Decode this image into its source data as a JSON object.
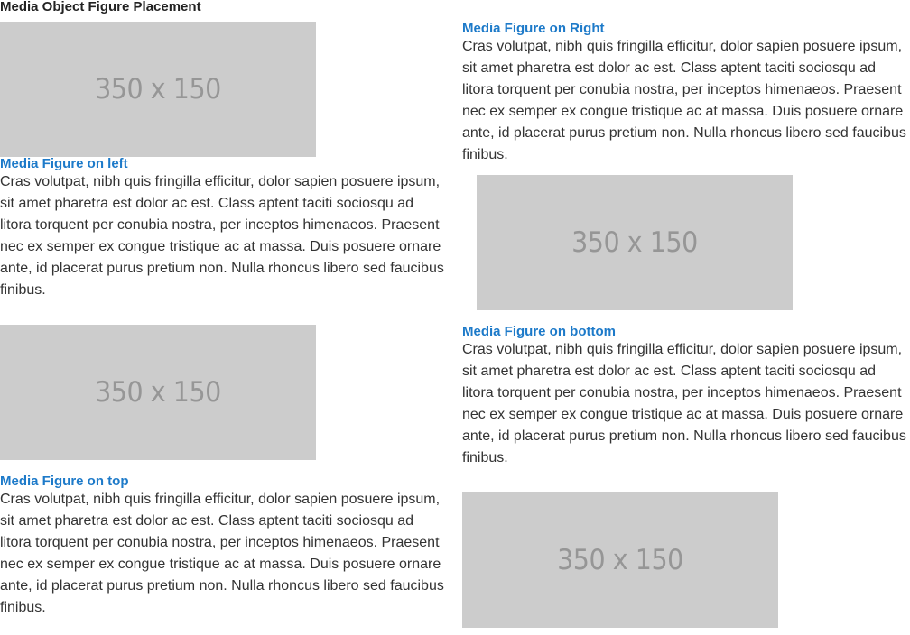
{
  "page": {
    "title": "Media Object Figure Placement"
  },
  "placeholder_label": "350 x 150",
  "body_text": "Cras volutpat, nibh quis fringilla efficitur, dolor sapien posuere ipsum, sit amet pharetra est dolor ac est. Class aptent taciti sociosqu ad litora torquent per conubia nostra, per inceptos himenaeos. Praesent nec ex semper ex congue tristique ac at massa. Duis posuere ornare ante, id placerat purus pretium non. Nulla rhoncus libero sed faucibus finibus.",
  "sections": {
    "left": {
      "heading": "Media Figure on left"
    },
    "right": {
      "heading": "Media Figure on Right"
    },
    "top": {
      "heading": "Media Figure on top"
    },
    "bottom": {
      "heading": "Media Figure on bottom"
    }
  },
  "colors": {
    "heading": "#1d7ac9",
    "text": "#333333",
    "placeholder_bg": "#cccccc",
    "placeholder_text": "#969696"
  }
}
